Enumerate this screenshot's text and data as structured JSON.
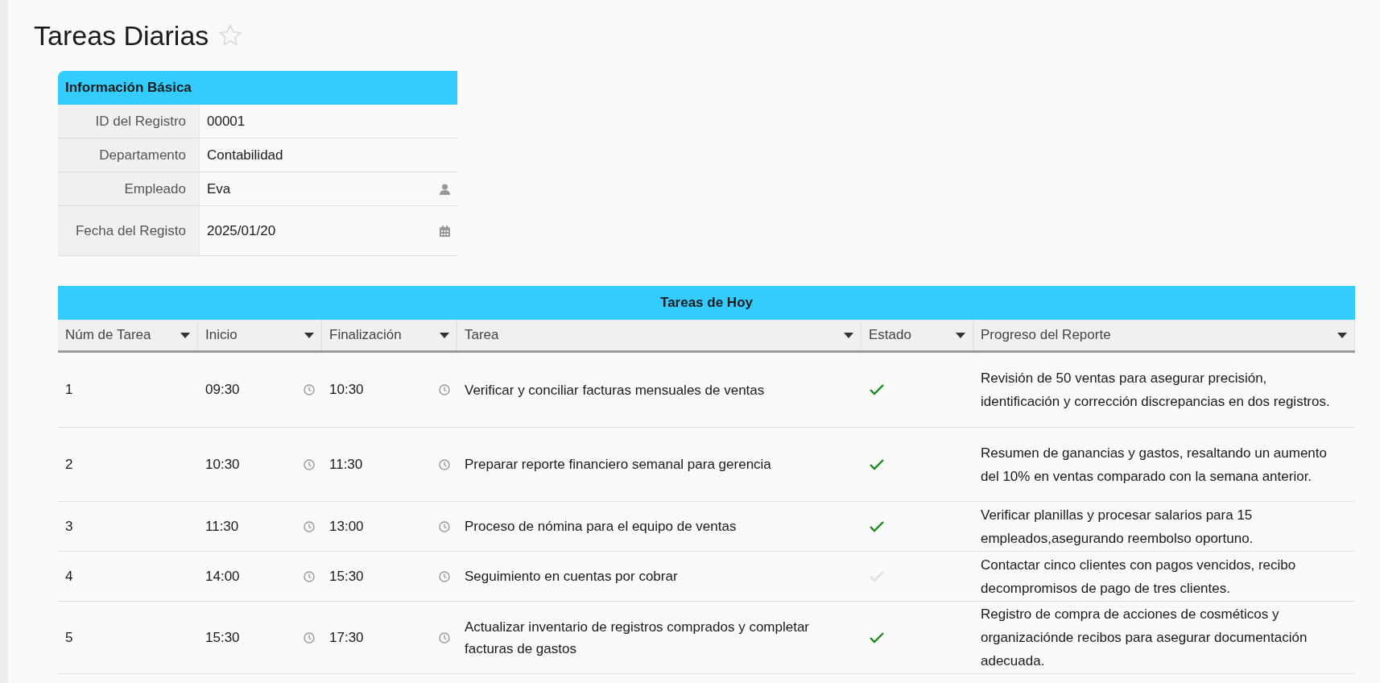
{
  "page": {
    "title": "Tareas Diarias",
    "favorite": false
  },
  "basic_info": {
    "title": "Información Básica",
    "fields": [
      {
        "label": "ID del Registro",
        "value": "00001",
        "kind": "text"
      },
      {
        "label": "Departamento",
        "value": "Contabilidad",
        "kind": "text"
      },
      {
        "label": "Empleado",
        "value": "Eva",
        "kind": "user"
      },
      {
        "label": "Fecha del Registo",
        "value": "2025/01/20",
        "kind": "date"
      }
    ]
  },
  "tasks": {
    "title": "Tareas de Hoy",
    "columns": [
      "Núm de Tarea",
      "Inicio",
      "Finalización",
      "Tarea",
      "Estado",
      "Progreso del Reporte"
    ],
    "rows": [
      {
        "number": "1",
        "start": "09:30",
        "end": "10:30",
        "task": "Verificar y conciliar facturas mensuales de ventas",
        "done": true,
        "report": "Revisión de 50 ventas para asegurar precisión, identificación y corrección discrepancias en dos registros."
      },
      {
        "number": "2",
        "start": "10:30",
        "end": "11:30",
        "task": "Preparar reporte financiero semanal para gerencia",
        "done": true,
        "report": "Resumen de ganancias y gastos, resaltando un aumento del 10% en ventas comparado con la semana anterior."
      },
      {
        "number": "3",
        "start": "11:30",
        "end": "13:00",
        "task": "Proceso de nómina para el equipo de ventas",
        "done": true,
        "report": "Verificar planillas y procesar salarios para 15 empleados,asegurando reembolso oportuno."
      },
      {
        "number": "4",
        "start": "14:00",
        "end": "15:30",
        "task": "Seguimiento en cuentas por cobrar",
        "done": false,
        "report": "Contactar cinco clientes con pagos vencidos, recibo decompromisos de pago de tres clientes."
      },
      {
        "number": "5",
        "start": "15:30",
        "end": "17:30",
        "task": "Actualizar inventario de registros comprados y completar facturas de gastos",
        "done": true,
        "report": "Registro de compra de acciones de cosméticos y organizaciónde recibos para asegurar documentación adecuada."
      }
    ]
  }
}
